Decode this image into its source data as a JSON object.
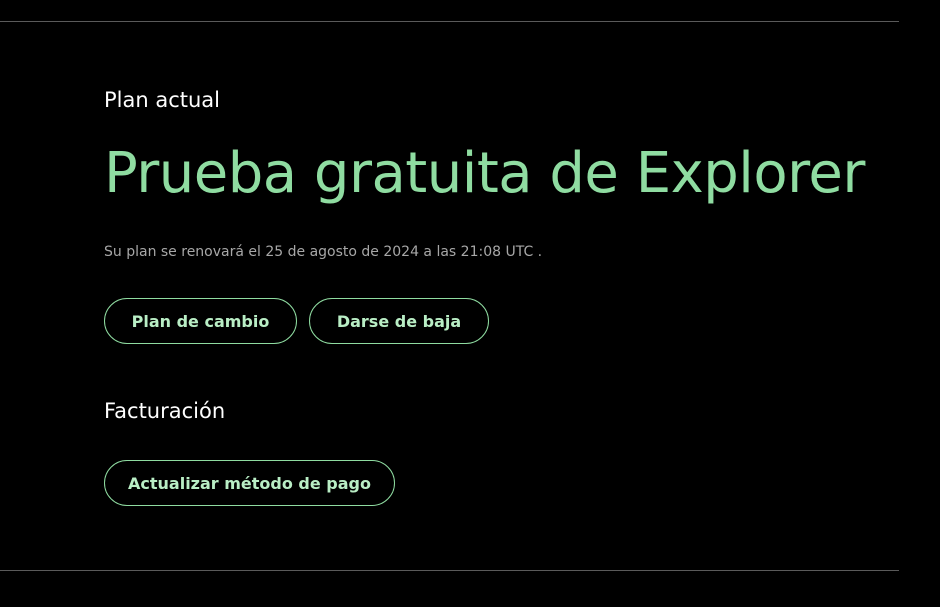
{
  "plan": {
    "section_label": "Plan actual",
    "name": "Prueba gratuita de Explorer",
    "renewal_text": "Su plan se renovará el 25 de agosto de 2024 a las 21:08 UTC .",
    "change_button": "Plan de cambio",
    "cancel_button": "Darse de baja"
  },
  "billing": {
    "section_label": "Facturación",
    "update_payment_button": "Actualizar método de pago"
  },
  "colors": {
    "background": "#000000",
    "accent_green": "#8fdca1",
    "muted_text": "#a7a7a7"
  }
}
